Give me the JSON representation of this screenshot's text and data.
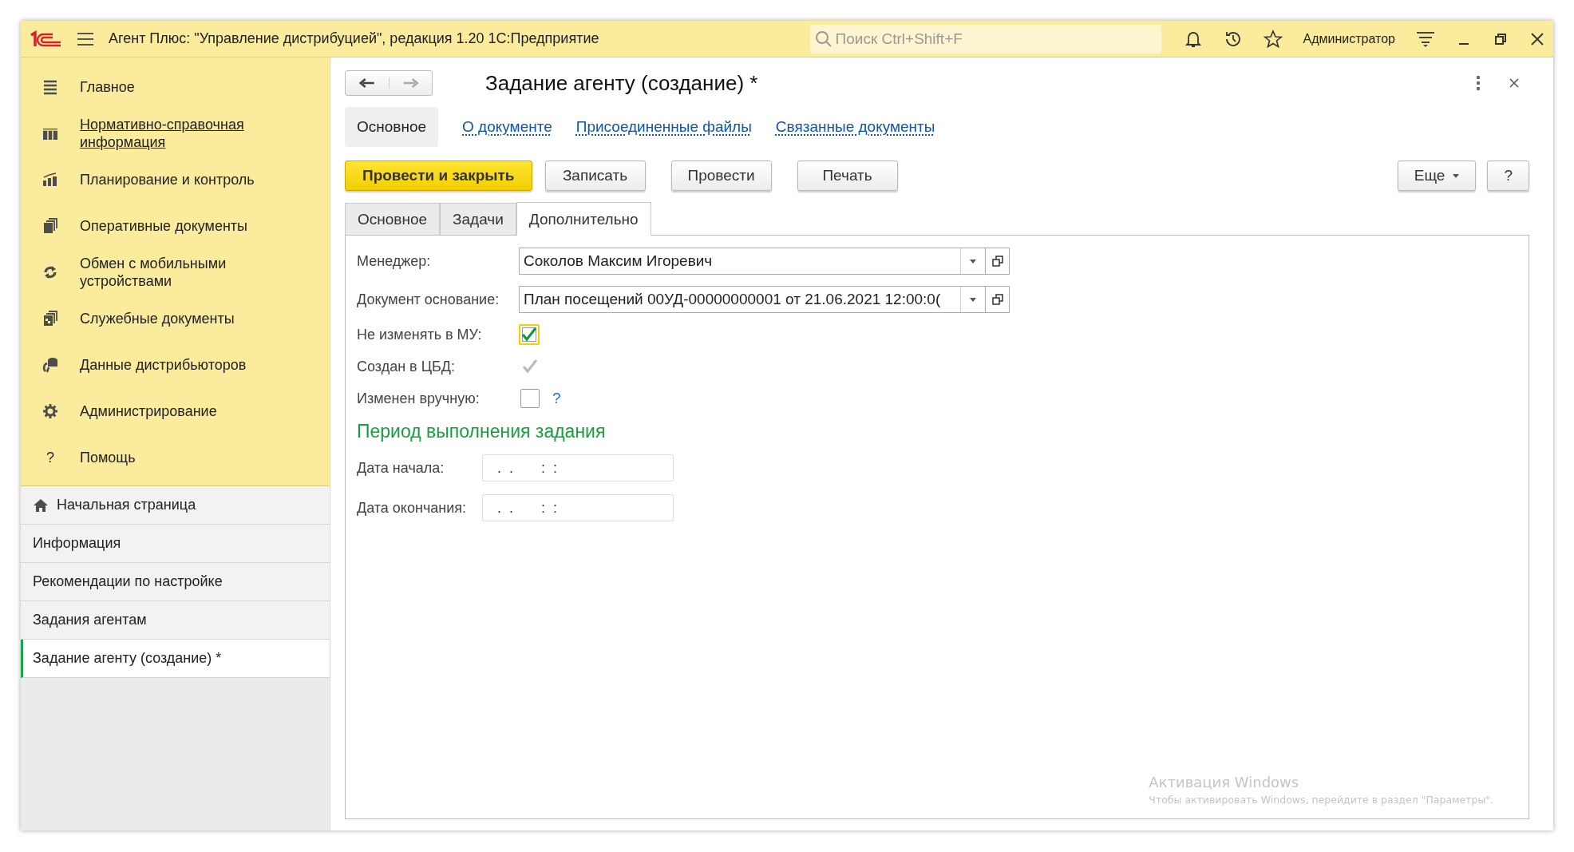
{
  "window": {
    "title": "Агент Плюс: \"Управление дистрибуцией\", редакция 1.20 1С:Предприятие",
    "search": {
      "placeholder": "Поиск Ctrl+Shift+F"
    },
    "user": "Администратор"
  },
  "sidebar": {
    "sections": [
      {
        "kind": "menu",
        "label": "Главное",
        "link": false
      },
      {
        "kind": "catalog",
        "label": "Нормативно-справочная информация",
        "link": true
      },
      {
        "kind": "chart",
        "label": "Планирование и контроль",
        "link": false
      },
      {
        "kind": "docs",
        "label": "Оперативные документы",
        "link": false
      },
      {
        "kind": "sync",
        "label": "Обмен с мобильными устройствами",
        "link": false
      },
      {
        "kind": "service",
        "label": "Служебные документы",
        "link": false
      },
      {
        "kind": "database",
        "label": "Данные дистрибьюторов",
        "link": false
      },
      {
        "kind": "gear",
        "label": "Администрирование",
        "link": false
      },
      {
        "kind": "help",
        "label": "Помощь",
        "link": false,
        "glyph": "?"
      }
    ],
    "open_windows": [
      {
        "label": "Начальная страница",
        "home": true,
        "selected": false
      },
      {
        "label": "Информация",
        "home": false,
        "selected": false
      },
      {
        "label": "Рекомендации по настройке",
        "home": false,
        "selected": false
      },
      {
        "label": "Задания агентам",
        "home": false,
        "selected": false
      },
      {
        "label": "Задание агенту (создание) *",
        "home": false,
        "selected": true
      }
    ]
  },
  "form": {
    "title": "Задание агенту (создание) *",
    "nav_tabs": [
      {
        "label": "Основное",
        "selected": true
      },
      {
        "label": "О документе",
        "selected": false
      },
      {
        "label": "Присоединенные файлы",
        "selected": false
      },
      {
        "label": "Связанные документы",
        "selected": false
      }
    ],
    "buttons": [
      {
        "label": "Провести и закрыть",
        "kind": "primary"
      },
      {
        "label": "Записать",
        "kind": "normal"
      },
      {
        "label": "Провести",
        "kind": "normal"
      },
      {
        "label": "Печать",
        "kind": "normal"
      }
    ],
    "right_buttons": [
      {
        "label": "Еще",
        "kind": "menu"
      },
      {
        "label": "?",
        "kind": "normal"
      }
    ],
    "tabs": [
      {
        "label": "Основное",
        "selected": false
      },
      {
        "label": "Задачи",
        "selected": false
      },
      {
        "label": "Дополнительно",
        "selected": true
      }
    ],
    "fields": [
      {
        "kind": "select",
        "label": "Менеджер:",
        "value": "Соколов Максим Игоревич"
      },
      {
        "kind": "select",
        "label": "Документ основание:",
        "value": "План посещений 00УД-00000000001 от 21.06.2021 12:00:0("
      },
      {
        "kind": "checkbox",
        "label": "Не изменять в МУ:",
        "checked": true,
        "disabled": false,
        "focused": true
      },
      {
        "kind": "checkbox",
        "label": "Создан в ЦБД:",
        "checked": true,
        "disabled": true
      },
      {
        "kind": "checkbox",
        "label": "Изменен вручную:",
        "checked": false,
        "disabled": false,
        "help": "?"
      },
      {
        "kind": "heading",
        "label": "Период выполнения задания"
      },
      {
        "kind": "date",
        "label": "Дата начала:",
        "value": "  .  .       :  :"
      },
      {
        "kind": "date",
        "label": "Дата окончания:",
        "value": "  .  .       :  :"
      }
    ]
  },
  "os_notice": {
    "title": "Активация Windows",
    "text": "Чтобы активировать Windows, перейдите в раздел \"Параметры\"."
  }
}
